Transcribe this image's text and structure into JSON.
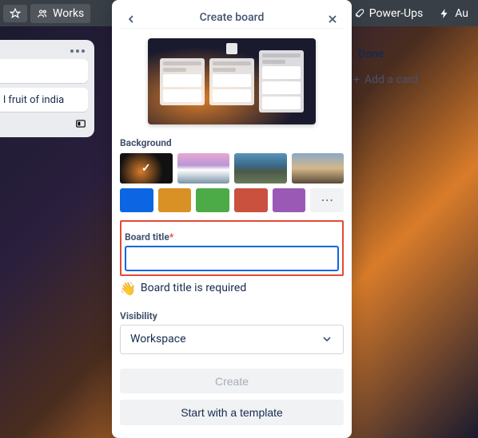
{
  "topbar": {
    "workspaces": "Works",
    "powerups": "Power-Ups",
    "automation": "Au"
  },
  "bg_list": {
    "card1": "",
    "card2": "l fruit of india"
  },
  "done": {
    "title": "Done",
    "add": "Add a card"
  },
  "modal": {
    "title": "Create board",
    "background_label": "Background",
    "swatches": [
      "#0c66e4",
      "#d99025",
      "#4caa47",
      "#c9513e",
      "#9b59b6"
    ],
    "title_label": "Board title",
    "required_mark": "*",
    "title_value": "",
    "required_msg": "Board title is required",
    "visibility_label": "Visibility",
    "visibility_value": "Workspace",
    "create": "Create",
    "start_template": "Start with a template",
    "more": "⋯"
  }
}
